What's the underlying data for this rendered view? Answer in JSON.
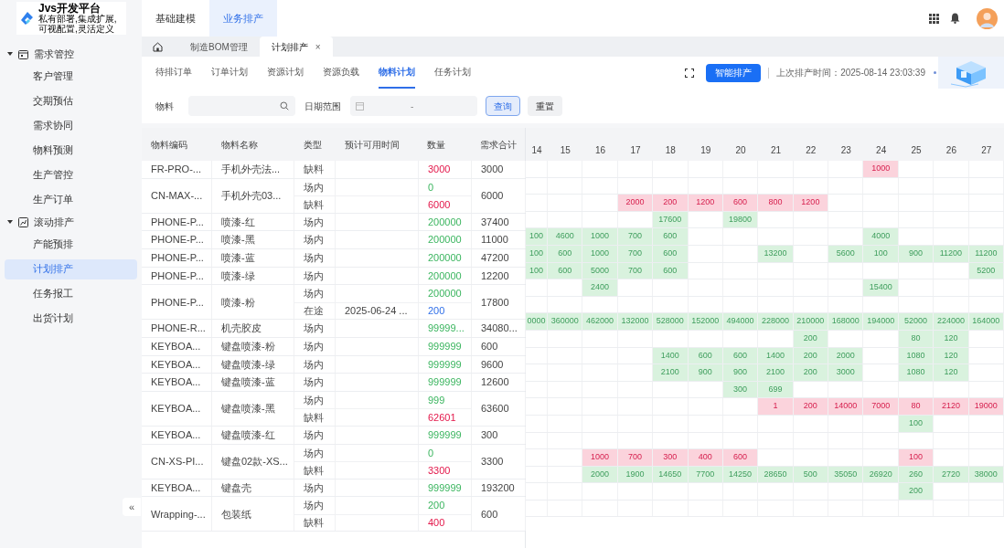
{
  "logo": {
    "title": "Jvs开发平台",
    "tagline": "私有部署,集成扩展,可视配置,灵活定义"
  },
  "top_nav": [
    {
      "label": "基础建模",
      "selected": false
    },
    {
      "label": "业务排产",
      "selected": true
    }
  ],
  "sidebar": {
    "groups": [
      {
        "label": "需求管控",
        "expanded": true,
        "items": [
          {
            "label": "客户管理",
            "selected": false
          },
          {
            "label": "交期预估",
            "selected": false
          },
          {
            "label": "需求协同",
            "selected": false
          },
          {
            "label": "物料预测",
            "selected": false
          },
          {
            "label": "生产管控",
            "selected": false
          },
          {
            "label": "生产订单",
            "selected": false
          }
        ]
      },
      {
        "label": "滚动排产",
        "expanded": true,
        "items": [
          {
            "label": "产能预排",
            "selected": false
          },
          {
            "label": "计划排产",
            "selected": true
          },
          {
            "label": "任务报工",
            "selected": false
          },
          {
            "label": "出货计划",
            "selected": false
          }
        ]
      }
    ],
    "collapse": "«"
  },
  "page_tabs": [
    {
      "label": "制造BOM管理",
      "selected": false,
      "closable": false
    },
    {
      "label": "计划排产",
      "selected": true,
      "closable": true,
      "close": "×"
    }
  ],
  "sub_tabs": [
    {
      "label": "待排订单",
      "selected": false
    },
    {
      "label": "订单计划",
      "selected": false
    },
    {
      "label": "资源计划",
      "selected": false
    },
    {
      "label": "资源负载",
      "selected": false
    },
    {
      "label": "物料计划",
      "selected": true
    },
    {
      "label": "任务计划",
      "selected": false
    }
  ],
  "schedule_button": "智能排产",
  "last_run": "上次排产时间：2025-08-14 23:03:39",
  "filters": {
    "material_label": "物料",
    "date_label": "日期范围",
    "date_separator": "-",
    "query": "查询",
    "reset": "重置"
  },
  "table": {
    "columns": [
      "物料编码",
      "物料名称",
      "类型",
      "预计可用时间",
      "数量",
      "需求合计"
    ],
    "days": [
      "14",
      "15",
      "16",
      "17",
      "18",
      "19",
      "20",
      "21",
      "22",
      "23",
      "24",
      "25",
      "26",
      "27"
    ],
    "groups": [
      {
        "code": "FR-PRO-...",
        "name": "手机外壳法...",
        "demand": "3000",
        "rows": [
          {
            "kind": "shortage",
            "type": "缺料",
            "qty": "3000",
            "cells": [
              null,
              null,
              null,
              null,
              null,
              null,
              null,
              null,
              null,
              null,
              "1000",
              null,
              null,
              null
            ]
          }
        ]
      },
      {
        "code": "CN-MAX-...",
        "name": "手机外壳03...",
        "demand": "6000",
        "rows": [
          {
            "kind": "onsite",
            "type": "场内",
            "qty": "0",
            "cells": [
              null,
              null,
              null,
              null,
              null,
              null,
              null,
              null,
              null,
              null,
              null,
              null,
              null,
              null
            ]
          },
          {
            "kind": "shortage",
            "type": "缺料",
            "qty": "6000",
            "cells": [
              null,
              null,
              null,
              "2000",
              "200",
              "1200",
              "600",
              "800",
              "1200",
              null,
              null,
              null,
              null,
              null
            ]
          }
        ]
      },
      {
        "code": "PHONE-P...",
        "name": "喷漆-红",
        "demand": "37400",
        "rows": [
          {
            "kind": "onsite",
            "type": "场内",
            "qty": "200000",
            "cells": [
              null,
              null,
              null,
              null,
              "17600",
              null,
              "19800",
              null,
              null,
              null,
              null,
              null,
              null,
              null
            ]
          }
        ]
      },
      {
        "code": "PHONE-P...",
        "name": "喷漆-黑",
        "demand": "11000",
        "rows": [
          {
            "kind": "onsite",
            "type": "场内",
            "qty": "200000",
            "cells": [
              "100",
              "4600",
              "1000",
              "700",
              "600",
              null,
              null,
              null,
              null,
              null,
              "4000",
              null,
              null,
              null
            ]
          }
        ]
      },
      {
        "code": "PHONE-P...",
        "name": "喷漆-蓝",
        "demand": "47200",
        "rows": [
          {
            "kind": "onsite",
            "type": "场内",
            "qty": "200000",
            "cells": [
              "100",
              "600",
              "1000",
              "700",
              "600",
              null,
              null,
              "13200",
              null,
              "5600",
              "100",
              "900",
              "11200",
              "11200"
            ]
          }
        ]
      },
      {
        "code": "PHONE-P...",
        "name": "喷漆-绿",
        "demand": "12200",
        "rows": [
          {
            "kind": "onsite",
            "type": "场内",
            "qty": "200000",
            "cells": [
              "100",
              "600",
              "5000",
              "700",
              "600",
              null,
              null,
              null,
              null,
              null,
              null,
              null,
              null,
              "5200"
            ]
          }
        ]
      },
      {
        "code": "PHONE-P...",
        "name": "喷漆-粉",
        "demand": "17800",
        "rows": [
          {
            "kind": "onsite",
            "type": "场内",
            "qty": "200000",
            "cells": [
              null,
              null,
              "2400",
              null,
              null,
              null,
              null,
              null,
              null,
              null,
              "15400",
              null,
              null,
              null
            ]
          },
          {
            "kind": "transit",
            "type": "在途",
            "eta": "2025-06-24 ...",
            "qty": "200",
            "cells": [
              null,
              null,
              null,
              null,
              null,
              null,
              null,
              null,
              null,
              null,
              null,
              null,
              null,
              null
            ]
          }
        ]
      },
      {
        "code": "PHONE-R...",
        "name": "机壳胶皮",
        "demand": "34080...",
        "rows": [
          {
            "kind": "onsite",
            "type": "场内",
            "qty": "99999...",
            "cells": [
              "0000",
              "360000",
              "462000",
              "132000",
              "528000",
              "152000",
              "494000",
              "228000",
              "210000",
              "168000",
              "194000",
              "52000",
              "224000",
              "164000"
            ]
          }
        ]
      },
      {
        "code": "KEYBOA...",
        "name": "键盘喷漆-粉",
        "demand": "600",
        "rows": [
          {
            "kind": "onsite",
            "type": "场内",
            "qty": "999999",
            "cells": [
              null,
              null,
              null,
              null,
              null,
              null,
              null,
              null,
              "200",
              null,
              null,
              "80",
              "120",
              null
            ]
          }
        ]
      },
      {
        "code": "KEYBOA...",
        "name": "键盘喷漆-绿",
        "demand": "9600",
        "rows": [
          {
            "kind": "onsite",
            "type": "场内",
            "qty": "999999",
            "cells": [
              null,
              null,
              null,
              null,
              "1400",
              "600",
              "600",
              "1400",
              "200",
              "2000",
              null,
              "1080",
              "120",
              null
            ]
          }
        ]
      },
      {
        "code": "KEYBOA...",
        "name": "键盘喷漆-蓝",
        "demand": "12600",
        "rows": [
          {
            "kind": "onsite",
            "type": "场内",
            "qty": "999999",
            "cells": [
              null,
              null,
              null,
              null,
              "2100",
              "900",
              "900",
              "2100",
              "200",
              "3000",
              null,
              "1080",
              "120",
              null
            ]
          }
        ]
      },
      {
        "code": "KEYBOA...",
        "name": "键盘喷漆-黑",
        "demand": "63600",
        "rows": [
          {
            "kind": "onsite",
            "type": "场内",
            "qty": "999",
            "cells": [
              null,
              null,
              null,
              null,
              null,
              null,
              "300",
              "699",
              null,
              null,
              null,
              null,
              null,
              null
            ]
          },
          {
            "kind": "shortage",
            "type": "缺料",
            "qty": "62601",
            "cells": [
              null,
              null,
              null,
              null,
              null,
              null,
              null,
              "1",
              "200",
              "14000",
              "7000",
              "80",
              "2120",
              "19000"
            ]
          }
        ]
      },
      {
        "code": "KEYBOA...",
        "name": "键盘喷漆-红",
        "demand": "300",
        "rows": [
          {
            "kind": "onsite",
            "type": "场内",
            "qty": "999999",
            "cells": [
              null,
              null,
              null,
              null,
              null,
              null,
              null,
              null,
              null,
              null,
              null,
              "100",
              null,
              null
            ]
          }
        ]
      },
      {
        "code": "CN-XS-PI...",
        "name": "键盘02款-XS...",
        "demand": "3300",
        "rows": [
          {
            "kind": "onsite",
            "type": "场内",
            "qty": "0",
            "cells": [
              null,
              null,
              null,
              null,
              null,
              null,
              null,
              null,
              null,
              null,
              null,
              null,
              null,
              null
            ]
          },
          {
            "kind": "shortage",
            "type": "缺料",
            "qty": "3300",
            "cells": [
              null,
              null,
              "1000",
              "700",
              "300",
              "400",
              "600",
              null,
              null,
              null,
              null,
              "100",
              null,
              null
            ]
          }
        ]
      },
      {
        "code": "KEYBOA...",
        "name": "键盘壳",
        "demand": "193200",
        "rows": [
          {
            "kind": "onsite",
            "type": "场内",
            "qty": "999999",
            "cells": [
              null,
              null,
              "2000",
              "1900",
              "14650",
              "7700",
              "14250",
              "28650",
              "500",
              "35050",
              "26920",
              "260",
              "2720",
              "38000"
            ]
          }
        ]
      },
      {
        "code": "Wrapping-...",
        "name": "包装纸",
        "demand": "600",
        "rows": [
          {
            "kind": "onsite",
            "type": "场内",
            "qty": "200",
            "cells": [
              null,
              null,
              null,
              null,
              null,
              null,
              null,
              null,
              null,
              null,
              null,
              "200",
              null,
              null
            ]
          },
          {
            "kind": "shortage",
            "type": "缺料",
            "qty": "400",
            "cells": [
              null,
              null,
              null,
              null,
              null,
              null,
              null,
              null,
              null,
              null,
              null,
              null,
              null,
              null
            ]
          }
        ]
      }
    ]
  }
}
